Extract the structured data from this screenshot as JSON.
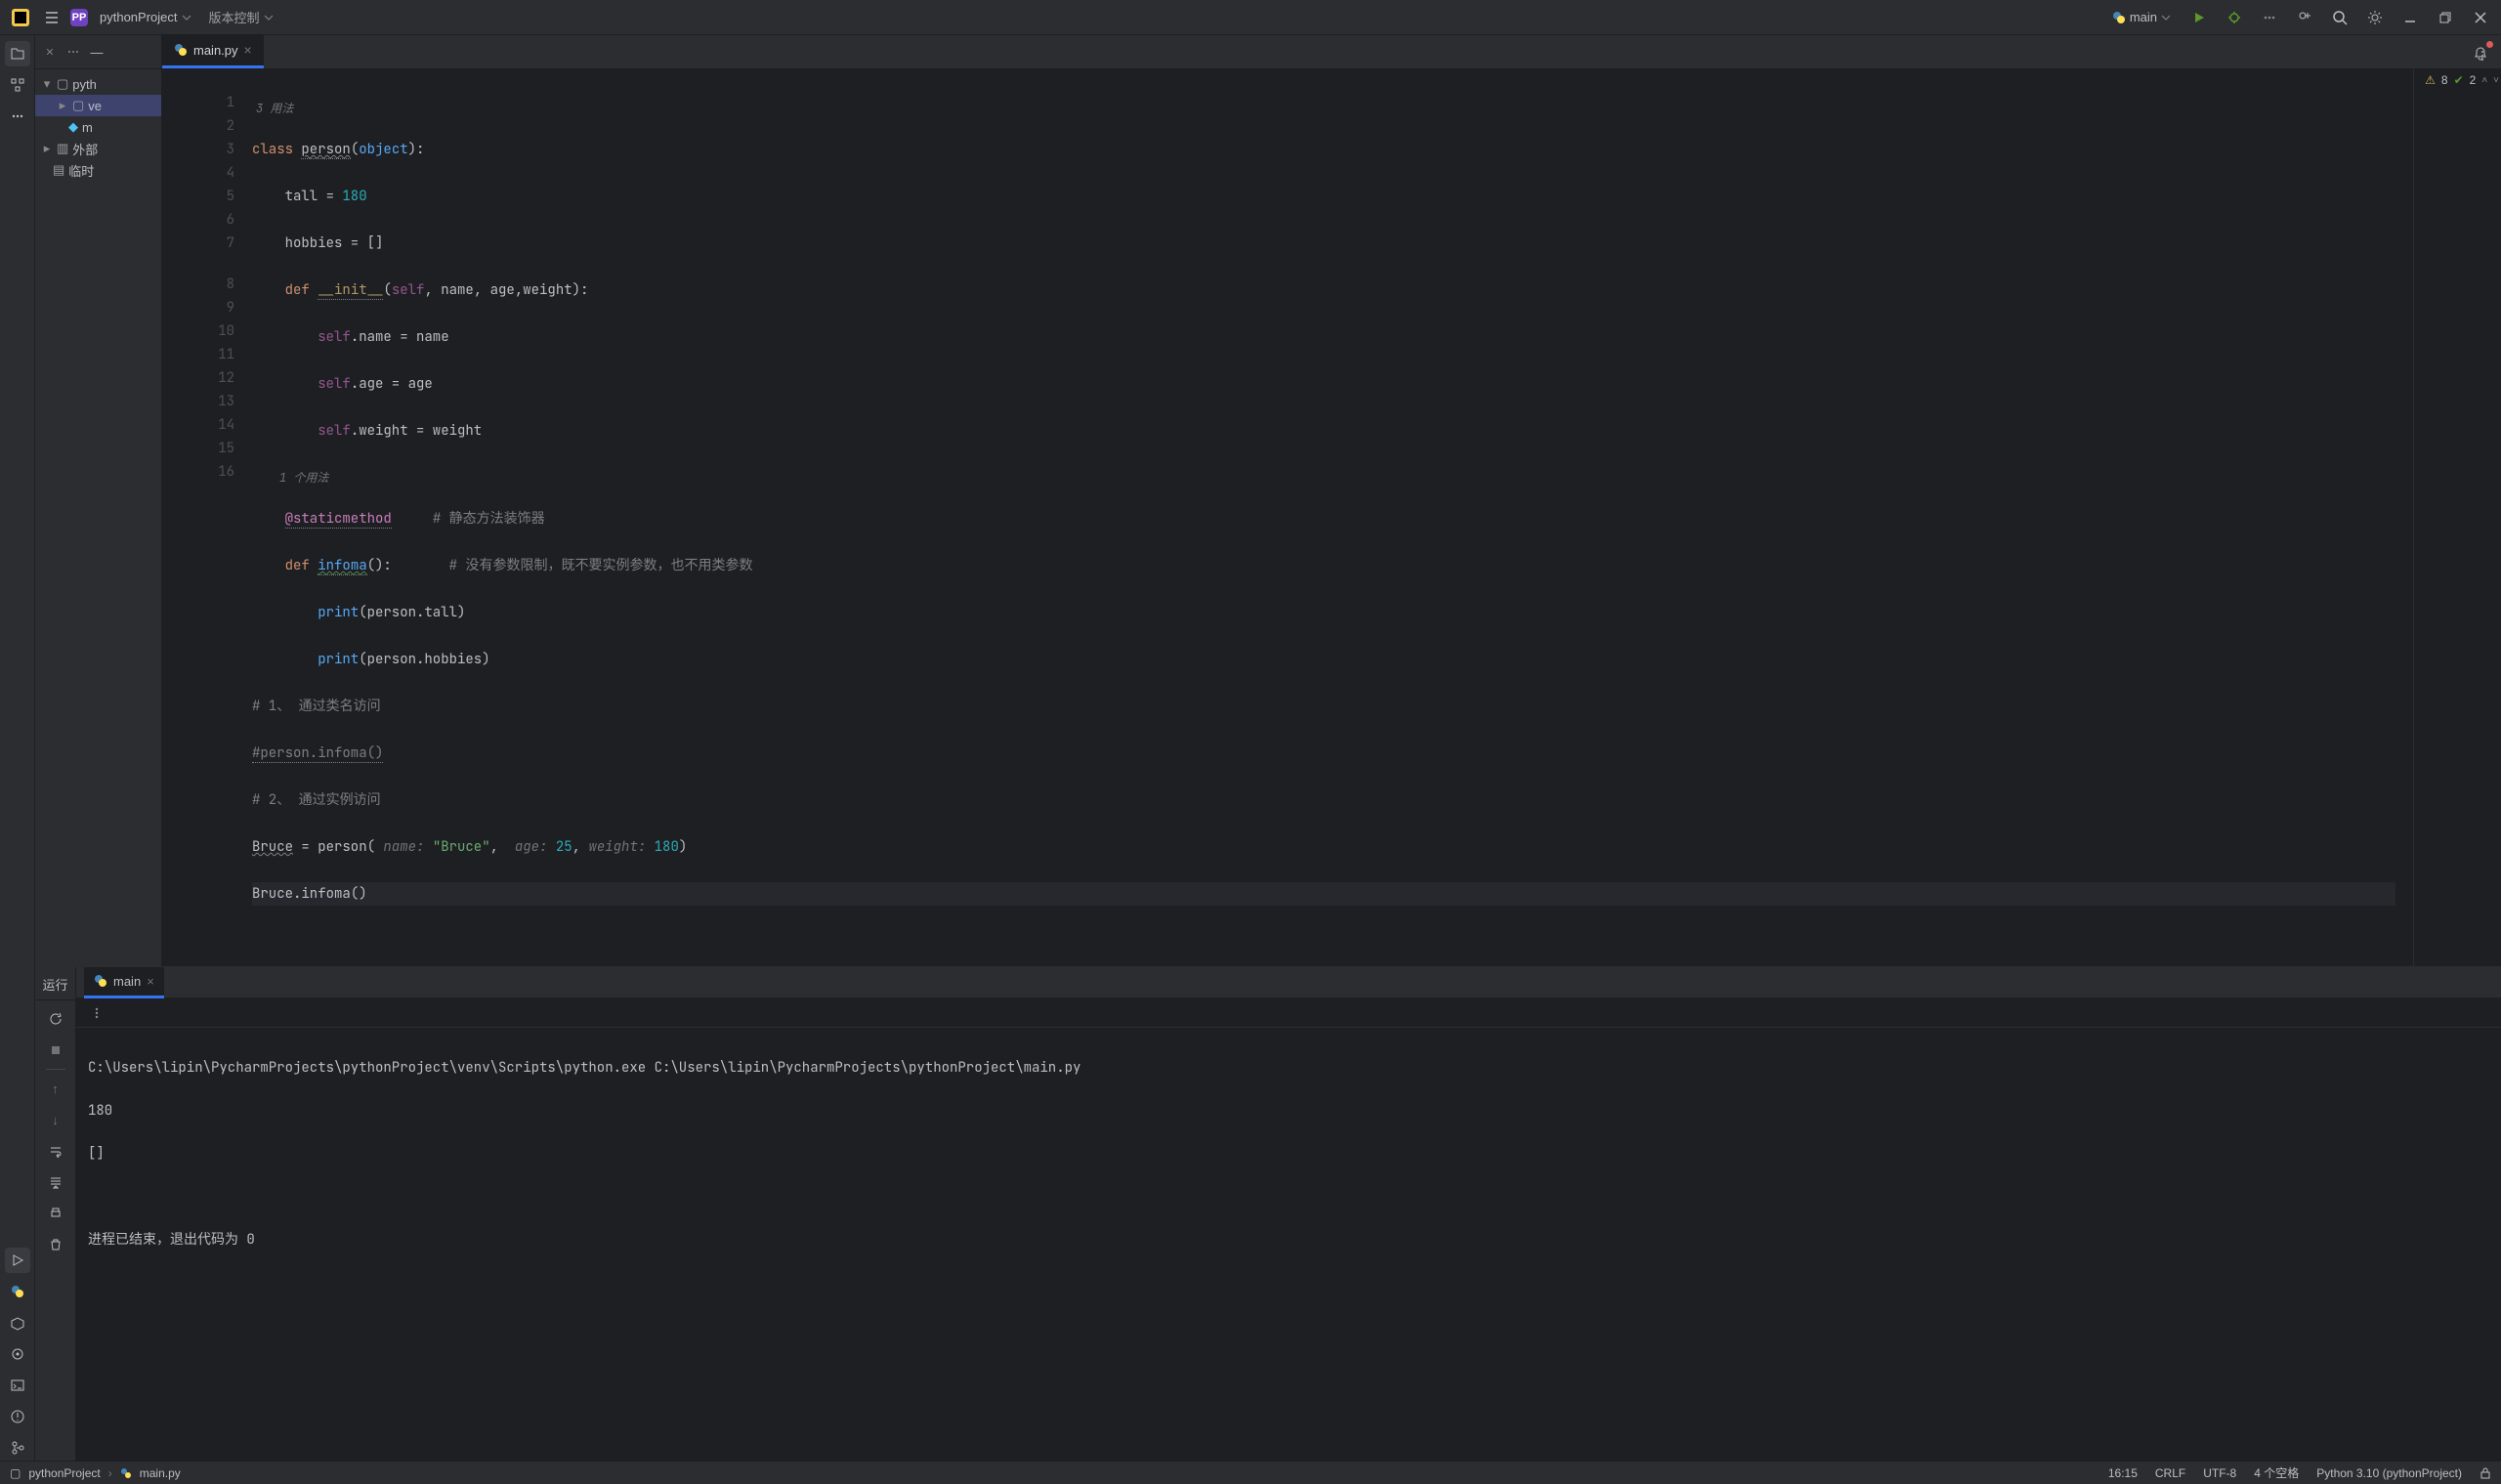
{
  "topbar": {
    "project_badge": "PP",
    "project_name": "pythonProject",
    "vcs_label": "版本控制",
    "run_config": "main"
  },
  "tree": {
    "root": "pyth",
    "venv": "ve",
    "main": "m",
    "ext_libs": "外部",
    "scratch": "临时"
  },
  "editor": {
    "tab_name": "main.py",
    "warnings": "8",
    "oks": "2",
    "inlay_usages_top": "3 用法",
    "inlay_usages_mid": "1 个用法",
    "lines": {
      "l1_a": "class ",
      "l1_b": "person",
      "l1_c": "(",
      "l1_d": "object",
      "l1_e": "):",
      "l2_a": "    tall = ",
      "l2_b": "180",
      "l3_a": "    hobbies = []",
      "l4_a": "    ",
      "l4_b": "def ",
      "l4_c": "__init__",
      "l4_d": "(",
      "l4_e": "self",
      "l4_f": ", name, age,weight):",
      "l5_a": "        ",
      "l5_b": "self",
      "l5_c": ".name = name",
      "l6_a": "        ",
      "l6_b": "self",
      "l6_c": ".age = age",
      "l7_a": "        ",
      "l7_b": "self",
      "l7_c": ".weight = weight",
      "l8_a": "    ",
      "l8_b": "@staticmethod",
      "l8_c": "     ",
      "l8_d": "# 静态方法装饰器",
      "l9_a": "    ",
      "l9_b": "def ",
      "l9_c": "infoma",
      "l9_d": "():",
      "l9_e": "       ",
      "l9_f": "# 没有参数限制，既不要实例参数，也不用类参数",
      "l10_a": "        ",
      "l10_b": "print",
      "l10_c": "(person.tall)",
      "l11_a": "        ",
      "l11_b": "print",
      "l11_c": "(person.hobbies)",
      "l12": "# 1、 通过类名访问",
      "l13": "#person.infoma()",
      "l14": "# 2、 通过实例访问",
      "l15_a": "Bruce",
      "l15_b": " = person( ",
      "l15_c": "name: ",
      "l15_d": "\"Bruce\"",
      "l15_e": ",  ",
      "l15_f": "age: ",
      "l15_g": "25",
      "l15_h": ", ",
      "l15_i": "weight: ",
      "l15_j": "180",
      "l15_k": ")",
      "l16": "Bruce.infoma()"
    }
  },
  "run": {
    "panel_title": "运行",
    "tab_name": "main",
    "out1": "C:\\Users\\lipin\\PycharmProjects\\pythonProject\\venv\\Scripts\\python.exe C:\\Users\\lipin\\PycharmProjects\\pythonProject\\main.py",
    "out2": "180",
    "out3": "[]",
    "out4": "",
    "out5": "进程已结束，退出代码为 0"
  },
  "status": {
    "bc1": "pythonProject",
    "bc2": "main.py",
    "pos": "16:15",
    "eol": "CRLF",
    "enc": "UTF-8",
    "indent": "4 个空格",
    "interp": "Python 3.10 (pythonProject)"
  }
}
